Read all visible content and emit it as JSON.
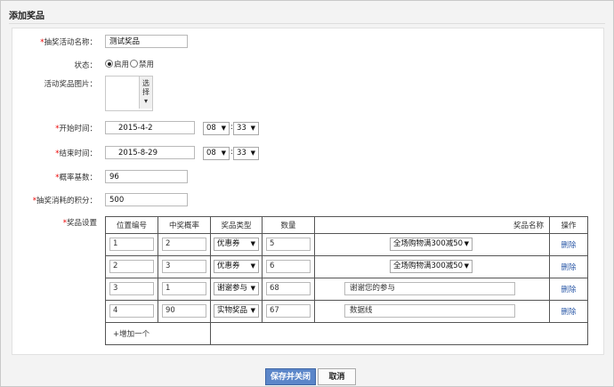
{
  "page_title": "添加奖品",
  "form": {
    "activity_name": {
      "label": "抽奖活动名称：",
      "value": "测试奖品"
    },
    "status": {
      "label": "状态：",
      "options": [
        "启用",
        "禁用"
      ],
      "selected": "启用"
    },
    "image": {
      "label": "活动奖品图片：",
      "button": "选择"
    },
    "start_time": {
      "label": "开始时间：",
      "date": "2015-4-2",
      "hour": "08",
      "minute": "33"
    },
    "end_time": {
      "label": "结束时间：",
      "date": "2015-8-29",
      "hour": "08",
      "minute": "33"
    },
    "probability_base": {
      "label": "概率基数：",
      "value": "96"
    },
    "points_cost": {
      "label": "抽奖消耗的积分：",
      "value": "500"
    },
    "prize_settings": {
      "label": "奖品设置"
    }
  },
  "prize_table": {
    "headers": [
      "位置编号",
      "中奖概率",
      "奖品类型",
      "数量",
      "奖品名称",
      "操作"
    ],
    "rows": [
      {
        "position": "1",
        "probability": "2",
        "type": "优惠券",
        "qty": "5",
        "name": "全场购物满300减50",
        "name_kind": "select",
        "action": "删除"
      },
      {
        "position": "2",
        "probability": "3",
        "type": "优惠券",
        "qty": "6",
        "name": "全场购物满300减50",
        "name_kind": "select",
        "action": "删除"
      },
      {
        "position": "3",
        "probability": "1",
        "type": "谢谢参与",
        "qty": "68",
        "name": "谢谢您的参与",
        "name_kind": "input",
        "action": "删除"
      },
      {
        "position": "4",
        "probability": "90",
        "type": "实物奖品",
        "qty": "67",
        "name": "数据线",
        "name_kind": "input",
        "action": "删除"
      }
    ],
    "add_row": "+增加一个"
  },
  "buttons": {
    "save": "保存并关闭",
    "cancel": "取消"
  },
  "colors": {
    "required": "#e00000",
    "link": "#2d5aa8",
    "primary": "#5b86c9"
  }
}
